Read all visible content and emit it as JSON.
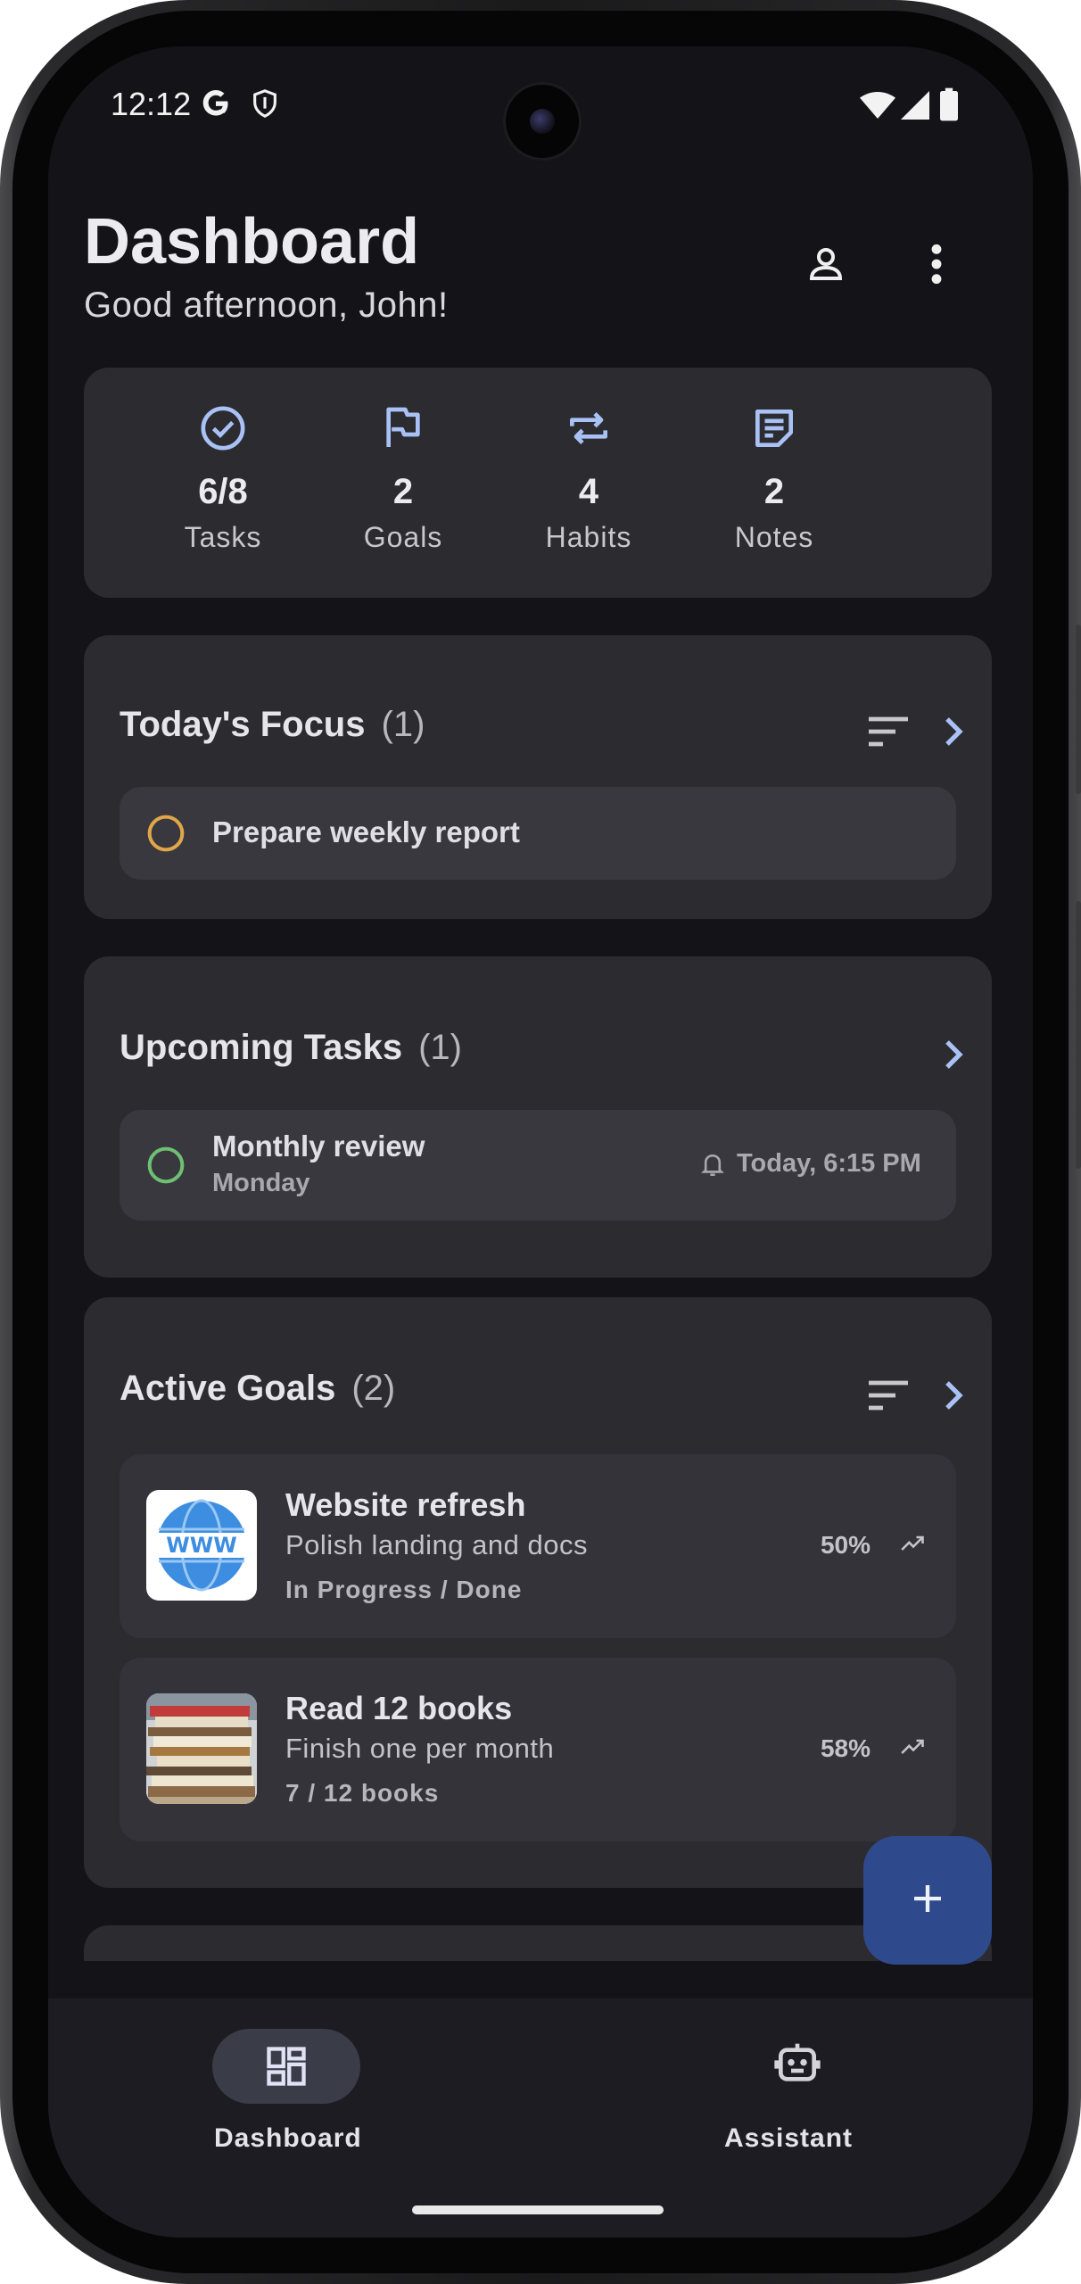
{
  "status_bar": {
    "time": "12:12"
  },
  "header": {
    "title": "Dashboard",
    "greeting": "Good afternoon, John!"
  },
  "stats": [
    {
      "icon": "check-circle-icon",
      "value": "6/8",
      "label": "Tasks"
    },
    {
      "icon": "flag-icon",
      "value": "2",
      "label": "Goals"
    },
    {
      "icon": "repeat-icon",
      "value": "4",
      "label": "Habits"
    },
    {
      "icon": "note-icon",
      "value": "2",
      "label": "Notes"
    }
  ],
  "focus": {
    "title": "Today's Focus",
    "count": "(1)",
    "items": [
      {
        "text": "Prepare weekly report",
        "ring_color": "#e0a64a"
      }
    ]
  },
  "upcoming": {
    "title": "Upcoming Tasks",
    "count": "(1)",
    "items": [
      {
        "text": "Monthly review",
        "day": "Monday",
        "reminder": "Today, 6:15 PM",
        "ring_color": "#6fbf73"
      }
    ]
  },
  "goals": {
    "title": "Active Goals",
    "count": "(2)",
    "items": [
      {
        "title": "Website refresh",
        "desc": "Polish landing and docs",
        "meta": "In Progress / Done",
        "percent": "50%",
        "progress": 0.5,
        "thumb_text": "WWW"
      },
      {
        "title": "Read 12 books",
        "desc": "Finish one per month",
        "meta": "7 / 12 books",
        "percent": "58%",
        "progress": 0.58
      }
    ]
  },
  "nav": {
    "items": [
      {
        "label": "Dashboard",
        "icon": "dashboard-icon",
        "active": true
      },
      {
        "label": "Assistant",
        "icon": "robot-icon",
        "active": false
      }
    ]
  },
  "colors": {
    "accent": "#a9c1f5",
    "background": "#141418",
    "card": "#2b2b30",
    "fab": "#2f4a8c"
  }
}
